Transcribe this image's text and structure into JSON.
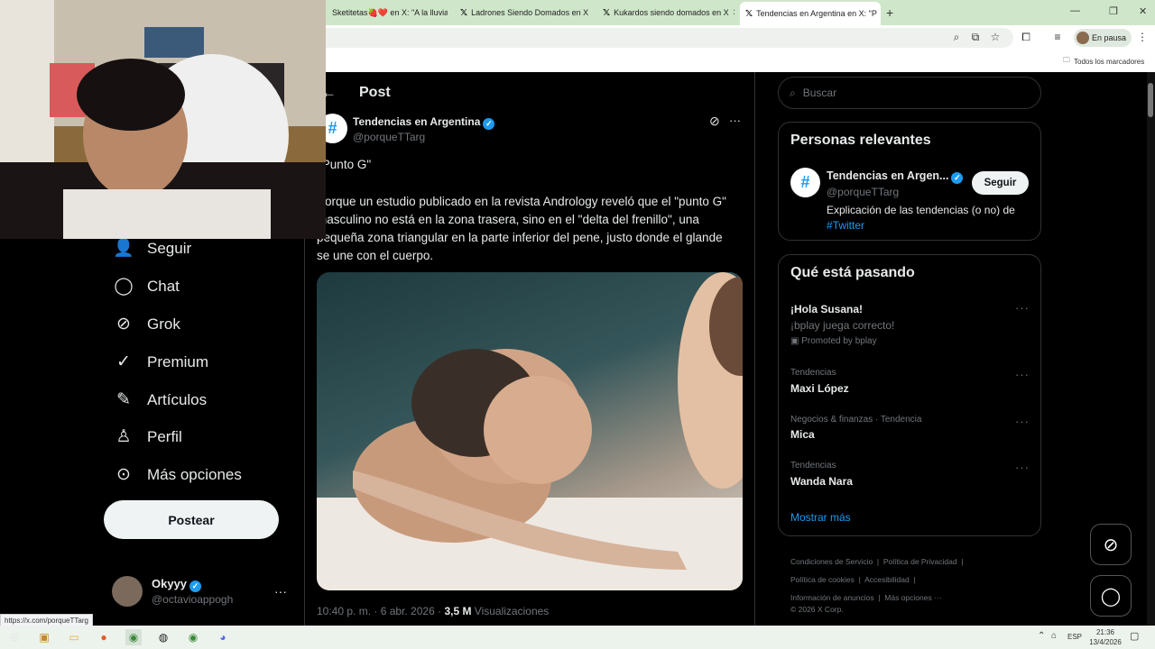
{
  "browser": {
    "tabs": [
      {
        "label": "Sketitetas🍓❤️ en X: \"A la lluvia",
        "active": false
      },
      {
        "label": "Ladrones Siendo Domados en X",
        "active": false
      },
      {
        "label": "Kukardos siendo domados en X",
        "active": false
      },
      {
        "label": "Tendencias en Argentina en X: \"P",
        "active": true
      }
    ],
    "profile_label": "En pausa",
    "bookmarks_folder": "Todos los marcadores",
    "status_url": "https://x.com/porqueTTarg"
  },
  "nav": {
    "items": [
      {
        "label": "Seguir",
        "icon": "follow-icon"
      },
      {
        "label": "Chat",
        "icon": "chat-icon"
      },
      {
        "label": "Grok",
        "icon": "grok-icon"
      },
      {
        "label": "Premium",
        "icon": "premium-icon"
      },
      {
        "label": "Artículos",
        "icon": "articles-icon"
      },
      {
        "label": "Perfil",
        "icon": "profile-icon"
      },
      {
        "label": "Más opciones",
        "icon": "more-icon"
      }
    ],
    "post_button": "Postear",
    "account": {
      "name": "Okyyy",
      "handle": "@octavioappogh",
      "more": "···"
    }
  },
  "post": {
    "header_title": "Post",
    "back": "←",
    "author": "Tendencias en Argentina",
    "handle": "@porqueTTarg",
    "text_line1": "\"Punto G\"",
    "text_body": "Porque un estudio publicado en la revista Andrology reveló que el \"punto G\" masculino no está en la zona trasera, sino en el \"delta del frenillo\", una pequeña zona triangular en la parte inferior del pene, justo donde el glande se une con el cuerpo.",
    "timestamp": "10:40 p. m. · 6 abr. 2026 ·",
    "views_count": "3,5 M",
    "views_label": "Visualizaciones",
    "more": "···"
  },
  "sidebar": {
    "search_placeholder": "Buscar",
    "relevant": {
      "title": "Personas relevantes",
      "name": "Tendencias en Argen...",
      "handle": "@porqueTTarg",
      "follow": "Seguir",
      "bio": "Explicación de las tendencias (o no) de",
      "bio_tag": "#Twitter"
    },
    "whats_happening": {
      "title": "Qué está pasando",
      "promo": {
        "title": "¡Hola Susana!",
        "subtitle": "¡bplay juega correcto!",
        "promoted": "Promoted by bplay"
      },
      "trends": [
        {
          "context": "Tendencias",
          "name": "Maxi López"
        },
        {
          "context": "Negocios & finanzas · Tendencia",
          "name": "Mica"
        },
        {
          "context": "Tendencias",
          "name": "Wanda Nara"
        }
      ],
      "show_more": "Mostrar más"
    },
    "footer": {
      "links": [
        "Condiciones de Servicio",
        "Política de Privacidad",
        "Política de cookies",
        "Accesibilidad",
        "Información de anuncios",
        "Más opciones ···"
      ],
      "copyright": "© 2026 X Corp."
    }
  },
  "taskbar": {
    "lang": "ESP",
    "time": "21:36",
    "date": "13/4/2026"
  },
  "colors": {
    "accent": "#1d9bf0",
    "background": "#000000",
    "chrome_tab": "#cfe6ca"
  }
}
